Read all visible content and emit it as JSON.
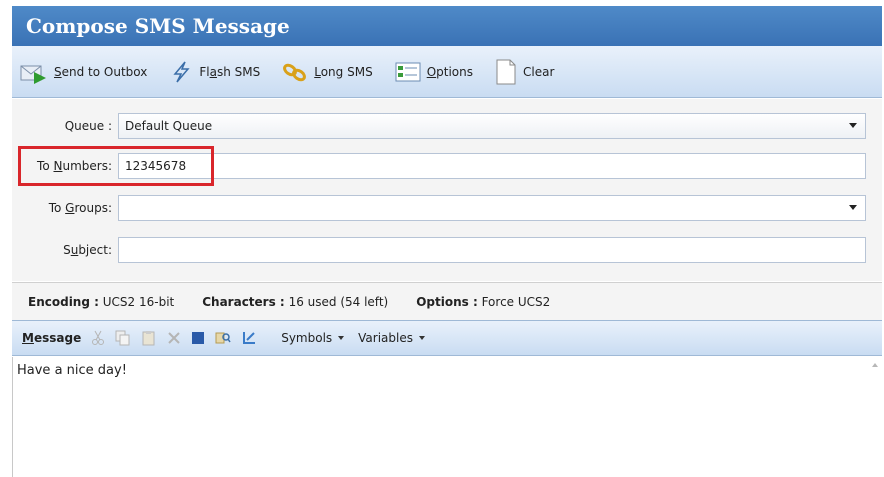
{
  "window": {
    "title": "Compose SMS Message"
  },
  "toolbar": {
    "send": {
      "pre": "",
      "u": "S",
      "post": "end to Outbox"
    },
    "flash": {
      "pre": "Fl",
      "u": "a",
      "post": "sh SMS"
    },
    "long": {
      "pre": "",
      "u": "L",
      "post": "ong SMS"
    },
    "options": {
      "pre": "",
      "u": "O",
      "post": "ptions"
    },
    "clear": "Clear"
  },
  "form": {
    "queue": {
      "label": "Queue :",
      "value": "Default Queue"
    },
    "to_numbers": {
      "label_pre": "To ",
      "label_u": "N",
      "label_post": "umbers:",
      "value": "12345678"
    },
    "to_groups": {
      "label_pre": "To ",
      "label_u": "G",
      "label_post": "roups:",
      "value": ""
    },
    "subject": {
      "label_pre": "S",
      "label_u": "u",
      "label_post": "bject:",
      "value": ""
    }
  },
  "status": {
    "encoding_key": "Encoding :",
    "encoding_val": "UCS2 16-bit",
    "characters_key": "Characters :",
    "characters_val": "16 used (54 left)",
    "options_key": "Options :",
    "options_val": "Force UCS2"
  },
  "message": {
    "label_u": "M",
    "label_rest": "essage",
    "symbols": "Symbols",
    "variables": "Variables",
    "text": "Have a nice day!"
  },
  "colors": {
    "title_bg": "#3f7bbf",
    "highlight": "#d9262b"
  }
}
